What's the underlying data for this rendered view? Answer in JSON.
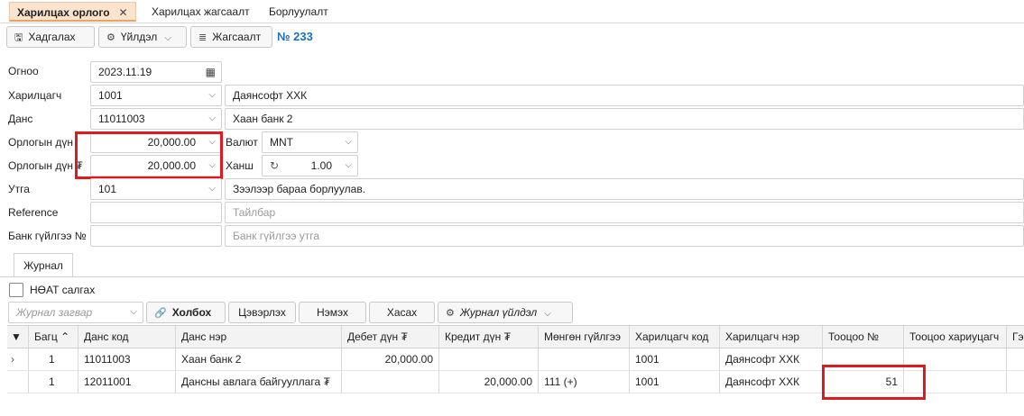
{
  "tabs": [
    {
      "label": "Харилцах орлого",
      "close": "✕"
    },
    {
      "label": "Харилцах жагсаалт"
    },
    {
      "label": "Борлуулалт"
    }
  ],
  "toolbar": {
    "save_label": "Хадгалах",
    "action_label": "Үйлдэл",
    "list_label": "Жагсаалт",
    "doc_number": "№ 233"
  },
  "form": {
    "date_label": "Огноо",
    "date_value": "2023.11.19",
    "partner_label": "Харилцагч",
    "partner_code": "1001",
    "partner_name": "Даянсофт ХХК",
    "account_label": "Данс",
    "account_code": "11011003",
    "account_name": "Хаан банк 2",
    "income_amount_label": "Орлогын дүн",
    "income_amount_value": "20,000.00",
    "currency_label": "Валют",
    "currency_value": "MNT",
    "income_amount_mnt_label": "Орлогын дүн ₮",
    "income_amount_mnt_value": "20,000.00",
    "rate_label": "Ханш",
    "rate_value": "1.00",
    "purpose_label": "Утга",
    "purpose_code": "101",
    "purpose_text": "Зээлээр бараа борлуулав.",
    "reference_label": "Reference",
    "reference_value": "",
    "description_placeholder": "Тайлбар",
    "bank_tx_label": "Банк гүйлгээ №",
    "bank_tx_value": "",
    "bank_tx_text_placeholder": "Банк гүйлгээ утга"
  },
  "journal": {
    "tab_label": "Журнал",
    "vat_label": "НӨАТ салгах",
    "template_placeholder": "Журнал загвар",
    "link_label": "Холбох",
    "clear_label": "Цэвэрлэх",
    "add_label": "Нэмэх",
    "delete_label": "Хасах",
    "action_label": "Журнал үйлдэл"
  },
  "grid": {
    "columns": [
      "Багц",
      "Данс код",
      "Данс нэр",
      "Дебет дүн ₮",
      "Кредит дүн ₮",
      "Мөнгөн гүйлгээ",
      "Харилцагч код",
      "Харилцагч нэр",
      "Тооцоо №",
      "Тооцоо хариуцагч",
      "Гэ"
    ],
    "rows": [
      {
        "expander": "›",
        "batch": "1",
        "acc_code": "11011003",
        "acc_name": "Хаан банк 2",
        "debit": "20,000.00",
        "credit": "",
        "cash": "",
        "partner_code": "1001",
        "partner_name": "Даянсофт ХХК",
        "settlement_no": "",
        "settlement_resp": ""
      },
      {
        "expander": "",
        "batch": "1",
        "acc_code": "12011001",
        "acc_name": "Дансны авлага байгууллага ₮",
        "debit": "",
        "credit": "20,000.00",
        "cash": "111 (+)",
        "partner_code": "1001",
        "partner_name": "Даянсофт ХХК",
        "settlement_no": "51",
        "settlement_resp": ""
      }
    ]
  },
  "colors": {
    "accent": "#1a6fc0",
    "highlight": "#e0191f",
    "active_tab": "#fbe3cd"
  }
}
